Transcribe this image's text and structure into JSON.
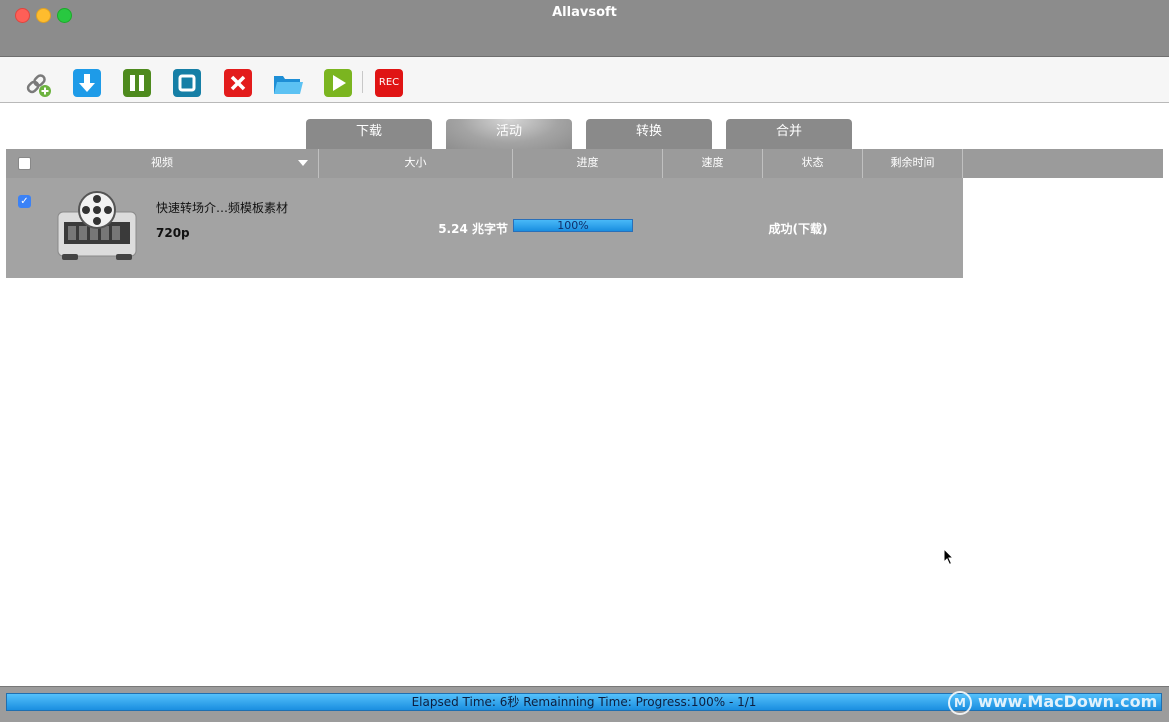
{
  "window": {
    "title": "Allavsoft"
  },
  "toolbar": {
    "buttons": [
      {
        "name": "link-add-icon"
      },
      {
        "name": "download-icon"
      },
      {
        "name": "pause-icon"
      },
      {
        "name": "stop-icon"
      },
      {
        "name": "delete-icon"
      },
      {
        "name": "folder-icon"
      },
      {
        "name": "play-icon"
      },
      {
        "name": "rec-icon",
        "label": "REC"
      }
    ]
  },
  "tabs": [
    "下载",
    "活动",
    "转换",
    "合并"
  ],
  "active_tab": "活动",
  "table": {
    "columns": [
      "视频",
      "大小",
      "进度",
      "速度",
      "状态",
      "剩余时间"
    ],
    "rows": [
      {
        "checked": true,
        "name": "快速转场介…频模板素材",
        "resolution": "720p",
        "size": "5.24 兆字节",
        "progress": 100,
        "progress_label": "100%",
        "speed": "",
        "status": "成功(下载)",
        "remaining": ""
      }
    ]
  },
  "statusbar": {
    "text": "Elapsed Time: 6秒 Remainning Time: Progress:100% - 1/1",
    "progress": 100
  },
  "watermark": {
    "logo": "M",
    "text": "www.MacDown.com"
  },
  "colors": {
    "titlebar": "#8c8c8c",
    "accent": "#1a8ee0",
    "close": "#fe5f57",
    "minimize": "#febc2e",
    "maximize": "#28c840"
  }
}
